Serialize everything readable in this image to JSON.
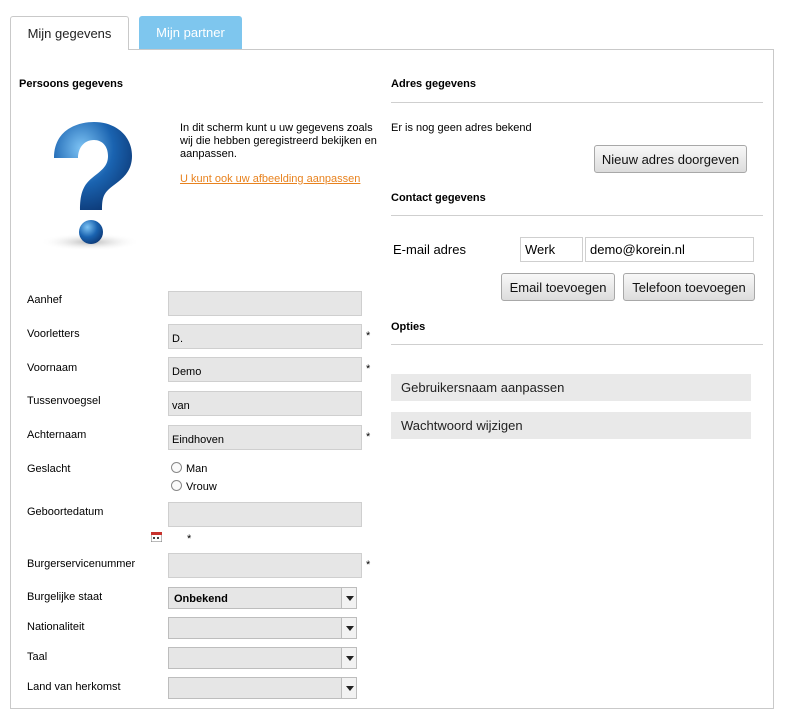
{
  "tabs": {
    "mine": "Mijn gegevens",
    "partner": "Mijn partner"
  },
  "persons": {
    "heading": "Persoons gegevens",
    "intro": "In dit scherm kunt u uw gegevens zoals wij die hebben geregistreerd bekijken en aanpassen.",
    "image_link": "U kunt ook uw afbeelding aanpassen"
  },
  "form": {
    "aanhef": {
      "label": "Aanhef",
      "value": ""
    },
    "voorletters": {
      "label": "Voorletters",
      "value": "D."
    },
    "voornaam": {
      "label": "Voornaam",
      "value": "Demo"
    },
    "tussenvoegsel": {
      "label": "Tussenvoegsel",
      "value": "van"
    },
    "achternaam": {
      "label": "Achternaam",
      "value": "Eindhoven"
    },
    "geslacht": {
      "label": "Geslacht",
      "option_man": "Man",
      "option_vrouw": "Vrouw"
    },
    "geboortedatum": {
      "label": "Geboortedatum",
      "value": ""
    },
    "bsn": {
      "label": "Burgerservicenummer",
      "value": ""
    },
    "burgelijke_staat": {
      "label": "Burgelijke staat",
      "value": "Onbekend"
    },
    "nationaliteit": {
      "label": "Nationaliteit",
      "value": ""
    },
    "taal": {
      "label": "Taal",
      "value": ""
    },
    "land": {
      "label": "Land van herkomst",
      "value": ""
    },
    "required_mark": "*"
  },
  "address": {
    "heading": "Adres gegevens",
    "empty_text": "Er is nog geen adres bekend",
    "new_button": "Nieuw adres doorgeven"
  },
  "contact": {
    "heading": "Contact gegevens",
    "email_label": "E-mail adres",
    "email_type": "Werk",
    "email_value": "demo@korein.nl",
    "add_email": "Email toevoegen",
    "add_phone": "Telefoon toevoegen"
  },
  "options": {
    "heading": "Opties",
    "items": [
      "Gebruikersnaam aanpassen",
      "Wachtwoord wijzigen"
    ]
  },
  "colors": {
    "tab_inactive": "#7ec6ee",
    "link": "#e8821e",
    "question_mark": "#1a63b0"
  },
  "icons": {
    "avatar": "question-mark-icon",
    "calendar": "calendar-icon"
  }
}
